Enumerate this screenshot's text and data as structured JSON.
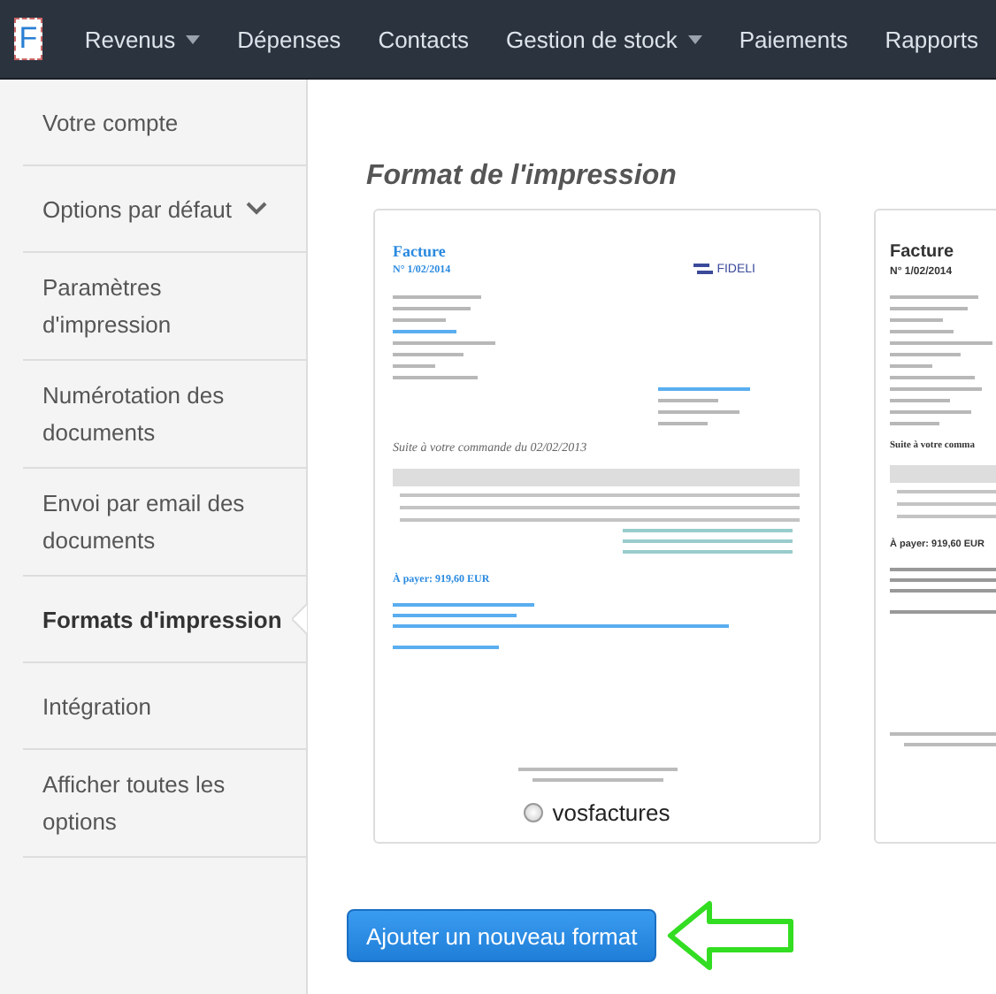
{
  "nav": {
    "logo": "F",
    "items": [
      {
        "label": "Revenus",
        "dropdown": true
      },
      {
        "label": "Dépenses",
        "dropdown": false
      },
      {
        "label": "Contacts",
        "dropdown": false
      },
      {
        "label": "Gestion de stock",
        "dropdown": true
      },
      {
        "label": "Paiements",
        "dropdown": false
      },
      {
        "label": "Rapports",
        "dropdown": false
      }
    ]
  },
  "sidebar": {
    "items": [
      {
        "label": "Votre compte",
        "selected": false,
        "expandable": false
      },
      {
        "label": "Options par défaut",
        "selected": false,
        "expandable": true
      },
      {
        "label": "Paramètres d'impression",
        "selected": false,
        "expandable": false
      },
      {
        "label": "Numérotation des documents",
        "selected": false,
        "expandable": false
      },
      {
        "label": "Envoi par email des documents",
        "selected": false,
        "expandable": false
      },
      {
        "label": "Formats d'impression",
        "selected": true,
        "expandable": false
      },
      {
        "label": "Intégration",
        "selected": false,
        "expandable": false
      },
      {
        "label": "Afficher toutes les options",
        "selected": false,
        "expandable": false
      }
    ]
  },
  "main": {
    "title": "Format de l'impression",
    "formats": [
      {
        "kind": "color",
        "heading": "Facture",
        "number": "N° 1/02/2014",
        "brand": "FIDELI",
        "order": "Suite à votre commande du 02/02/2013",
        "total": "À payer: 919,60 EUR",
        "name": "vosfactures",
        "selected": false
      },
      {
        "kind": "plain",
        "heading": "Facture",
        "number": "N° 1/02/2014",
        "order": "Suite à votre comma",
        "total": "À payer: 919,60 EUR"
      }
    ],
    "add_button": "Ajouter un nouveau format"
  }
}
